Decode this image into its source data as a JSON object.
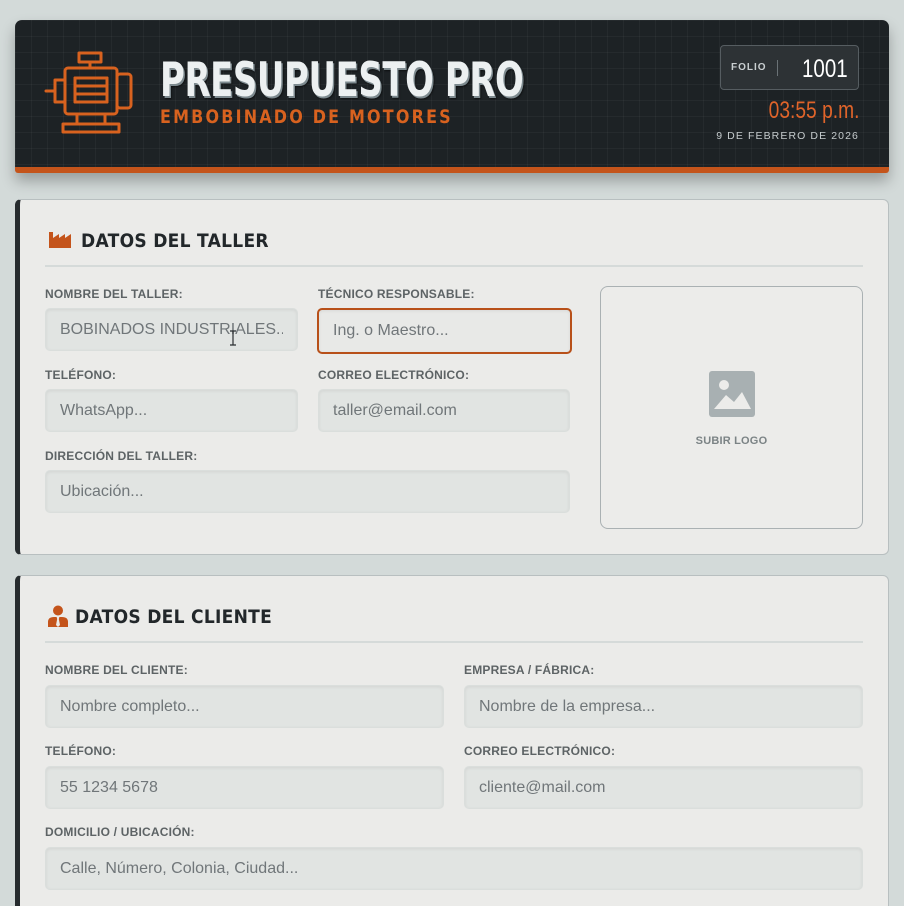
{
  "header": {
    "title": "PRESUPUESTO PRO",
    "subtitle": "EMBOBINADO DE MOTORES",
    "folio_label": "FOLIO",
    "folio_value": "1001",
    "time": "03:55 p.m.",
    "date": "9 DE FEBRERO DE 2026",
    "icon": "motor-icon"
  },
  "taller": {
    "title": "DATOS DEL TALLER",
    "icon": "factory-icon",
    "nombre": {
      "label": "NOMBRE DEL TALLER:",
      "placeholder": "BOBINADOS INDUSTRIALES..."
    },
    "tecnico": {
      "label": "TÉCNICO RESPONSABLE:",
      "placeholder": "Ing. o Maestro..."
    },
    "telefono": {
      "label": "TELÉFONO:",
      "placeholder": "WhatsApp..."
    },
    "correo": {
      "label": "CORREO ELECTRÓNICO:",
      "placeholder": "taller@email.com"
    },
    "direccion": {
      "label": "DIRECCIÓN DEL TALLER:",
      "placeholder": "Ubicación..."
    },
    "logo_label": "SUBIR LOGO"
  },
  "cliente": {
    "title": "DATOS DEL CLIENTE",
    "icon": "user-tie-icon",
    "nombre": {
      "label": "NOMBRE DEL CLIENTE:",
      "placeholder": "Nombre completo..."
    },
    "empresa": {
      "label": "EMPRESA / FÁBRICA:",
      "placeholder": "Nombre de la empresa..."
    },
    "telefono": {
      "label": "TELÉFONO:",
      "placeholder": "55 1234 5678"
    },
    "correo": {
      "label": "CORREO ELECTRÓNICO:",
      "placeholder": "cliente@mail.com"
    },
    "domicilio": {
      "label": "DOMICILIO / UBICACIÓN:",
      "placeholder": "Calle, Número, Colonia, Ciudad..."
    }
  },
  "colors": {
    "accent": "#c4541b",
    "header_bg": "#1d2225",
    "page_bg": "#d3dad9",
    "card_bg": "#ebebe9"
  }
}
